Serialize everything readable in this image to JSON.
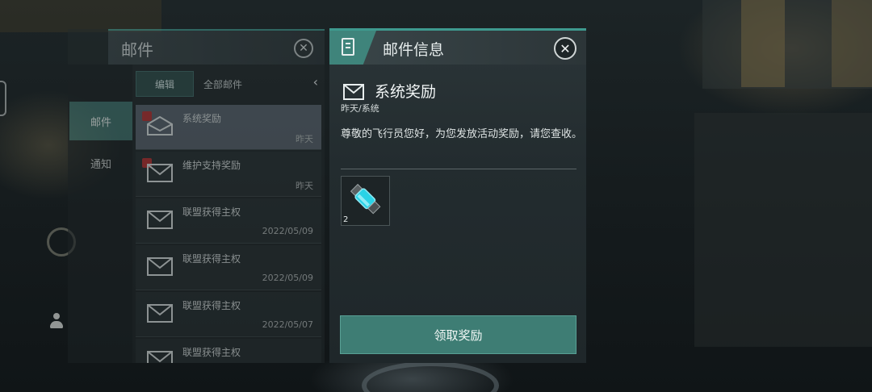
{
  "mail_panel": {
    "title": "邮件",
    "tabs": [
      {
        "label": "邮件",
        "active": true
      },
      {
        "label": "通知",
        "active": false
      }
    ],
    "edit_label": "编辑",
    "filter_label": "全部邮件",
    "items": [
      {
        "subject": "系统奖励",
        "date": "昨天",
        "unread": true,
        "selected": true
      },
      {
        "subject": "维护支持奖励",
        "date": "昨天",
        "unread": true,
        "selected": false
      },
      {
        "subject": "联盟获得主权",
        "date": "2022/05/09",
        "unread": false,
        "selected": false
      },
      {
        "subject": "联盟获得主权",
        "date": "2022/05/09",
        "unread": false,
        "selected": false
      },
      {
        "subject": "联盟获得主权",
        "date": "2022/05/07",
        "unread": false,
        "selected": false
      },
      {
        "subject": "联盟获得主权",
        "date": "",
        "unread": false,
        "selected": false
      }
    ]
  },
  "detail": {
    "title": "邮件信息",
    "subject": "系统奖励",
    "meta": "昨天/系统",
    "body": "尊敬的飞行员您好，为您发放活动奖励，请您查收。",
    "reward": {
      "icon": "energy-cell-icon",
      "quantity": "2"
    },
    "claim_label": "领取奖励"
  },
  "colors": {
    "accent": "#3e7d74",
    "accent_bright": "#3e9a8f",
    "unread_badge": "#b03030"
  }
}
